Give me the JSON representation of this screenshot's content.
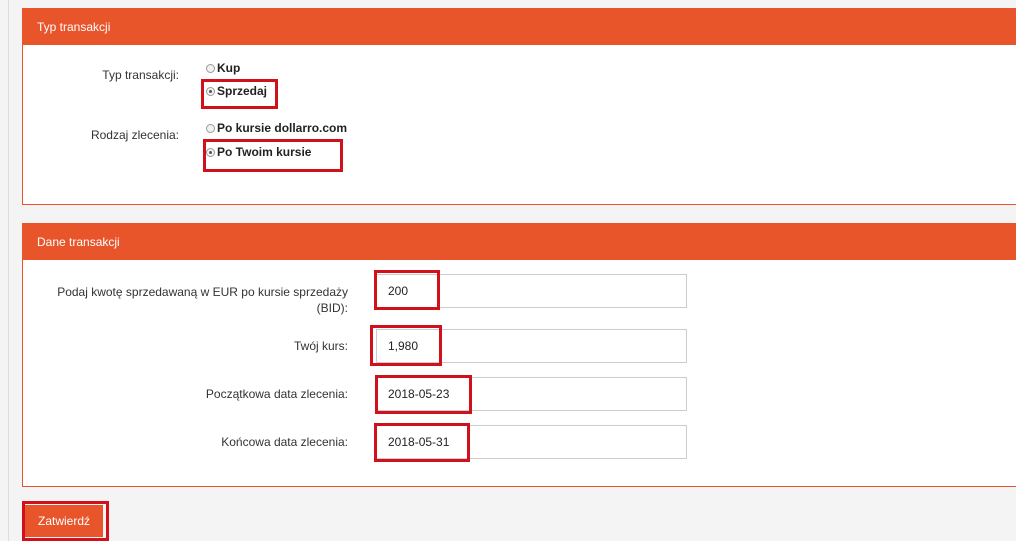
{
  "section1": {
    "title": "Typ transakcji",
    "type_label": "Typ transakcji:",
    "type_options": [
      "Kup",
      "Sprzedaj"
    ],
    "type_selected": "Sprzedaj",
    "order_label": "Rodzaj zlecenia:",
    "order_options": [
      "Po kursie dollarro.com",
      "Po Twoim kursie"
    ],
    "order_selected": "Po Twoim kursie"
  },
  "section2": {
    "title": "Dane transakcji",
    "amount_label_line1": "Podaj kwotę sprzedawaną w EUR po kursie sprzedaży",
    "amount_label_line2": "(BID):",
    "amount_value": "200",
    "rate_label": "Twój kurs:",
    "rate_value": "1,980",
    "start_label": "Początkowa data zlecenia:",
    "start_value": "2018-05-23",
    "end_label": "Końcowa data zlecenia:",
    "end_value": "2018-05-31"
  },
  "submit_label": "Zatwierdź",
  "colors": {
    "accent": "#e8552b",
    "highlight": "#d0101a"
  }
}
